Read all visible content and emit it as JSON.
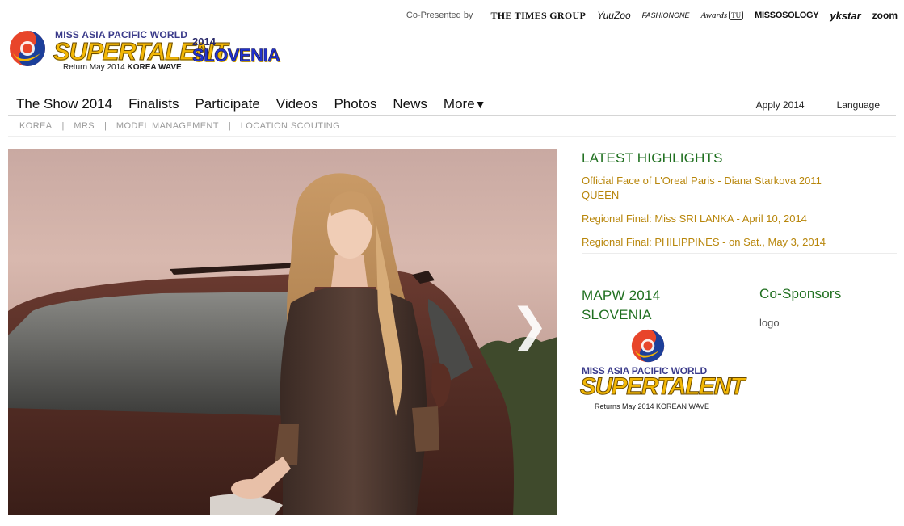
{
  "sponsors": {
    "copresented_label": "Co-Presented by",
    "items": [
      "THE TIMES GROUP",
      "YuuZoo",
      "FASHIONONE",
      "Awards",
      "TU",
      "MISSOSOLOGY",
      "ykstar",
      "zoom"
    ]
  },
  "logo": {
    "top_line": "MISS ASIA PACIFIC WORLD",
    "main": "SUPERTALENT",
    "year": "2014",
    "country": "SLOVENIA",
    "sub_prefix": "Return May 2014",
    "sub_bold": "KOREA WAVE"
  },
  "nav": {
    "items": [
      "The Show 2014",
      "Finalists",
      "Participate",
      "Videos",
      "Photos",
      "News",
      "More"
    ],
    "more_caret": "▼",
    "apply": "Apply 2014",
    "language": "Language"
  },
  "subnav": {
    "items": [
      "KOREA",
      "MRS",
      "MODEL MANAGEMENT",
      "LOCATION SCOUTING"
    ],
    "separator": "|"
  },
  "hero": {
    "next_glyph": "❯"
  },
  "highlights": {
    "title": "LATEST HIGHLIGHTS",
    "items": [
      "Official Face of L'Oreal Paris - Diana Starkova 2011 QUEEN",
      "Regional Final: Miss SRI LANKA - April 10, 2014",
      "Regional Final: PHILIPPINES - on Sat., May 3, 2014"
    ]
  },
  "mapw": {
    "title_line1": "MAPW 2014",
    "title_line2": "SLOVENIA",
    "logo_top": "MISS ASIA PACIFIC WORLD",
    "logo_main": "SUPERTALENT",
    "logo_sub": "Returns May 2014 KOREAN WAVE"
  },
  "cosponsors": {
    "title": "Co-Sponsors",
    "logo_placeholder": "logo"
  },
  "colors": {
    "accent_green": "#1f6f1f",
    "link_gold": "#b8860b",
    "logo_gold": "#f2b705",
    "logo_blue": "#2233cc"
  }
}
